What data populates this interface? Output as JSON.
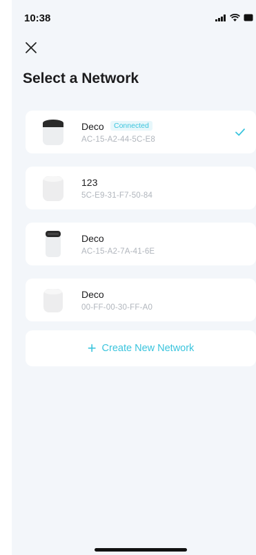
{
  "status_bar": {
    "time": "10:38"
  },
  "page": {
    "title": "Select a Network"
  },
  "networks": [
    {
      "name": "Deco",
      "mac": "AC-15-A2-44-5C-E8",
      "badge": "Connected",
      "selected": true
    },
    {
      "name": "123",
      "mac": "5C-E9-31-F7-50-84"
    },
    {
      "name": "Deco",
      "mac": "AC-15-A2-7A-41-6E"
    },
    {
      "name": "Deco",
      "mac": "00-FF-00-30-FF-A0"
    }
  ],
  "create_network": {
    "label": "Create New Network",
    "icon": "plus-icon"
  },
  "colors": {
    "accent": "#3ac4dd",
    "background": "#f3f6fa",
    "card": "#ffffff"
  }
}
